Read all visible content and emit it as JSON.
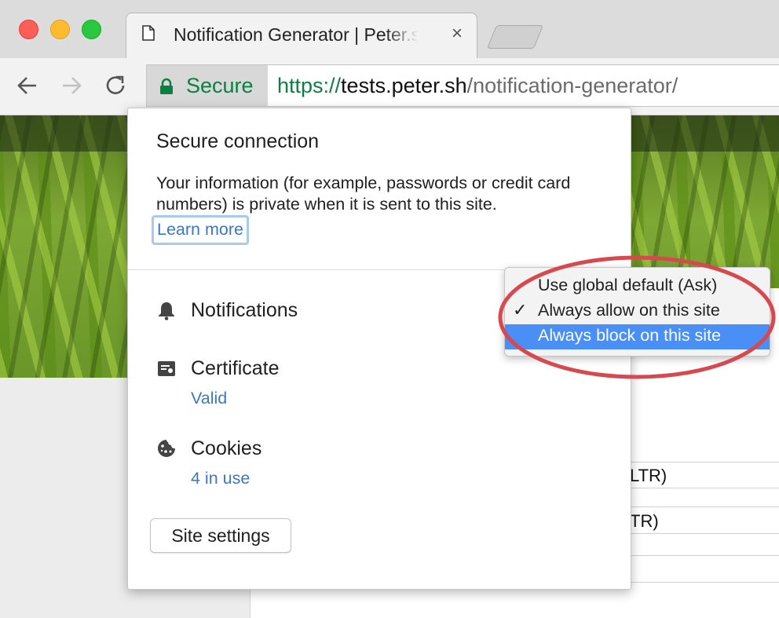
{
  "window": {
    "tab": {
      "title": "Notification Generator | Peter.sh",
      "close_glyph": "×"
    }
  },
  "toolbar": {
    "secure_label": "Secure",
    "url": {
      "scheme": "https://",
      "host": "tests.peter.sh",
      "path": "/notification-generator/"
    }
  },
  "popup": {
    "title": "Secure connection",
    "description": "Your information (for example, passwords or credit card numbers) is private when it is sent to this site.",
    "learn_more": "Learn more",
    "permissions": [
      {
        "label": "Notifications",
        "icon": "bell-icon"
      },
      {
        "label": "Certificate",
        "sublabel": "Valid",
        "icon": "certificate-icon"
      },
      {
        "label": "Cookies",
        "sublabel": "4 in use",
        "icon": "cookie-icon"
      }
    ],
    "site_settings_label": "Site settings"
  },
  "notifications_dropdown": {
    "options": [
      {
        "label": "Use global default (Ask)",
        "checked": false,
        "highlighted": false
      },
      {
        "label": "Always allow on this site",
        "checked": true,
        "highlighted": false
      },
      {
        "label": "Always block on this site",
        "checked": false,
        "highlighted": true
      }
    ],
    "check_glyph": "✓"
  },
  "page": {
    "form_fragments": [
      "LTR)",
      "TR)"
    ]
  },
  "colors": {
    "secure_green": "#0b8043",
    "link_blue": "#3b78c3",
    "highlight_blue": "#4a8ff6",
    "annotation_red": "#d8484f"
  }
}
